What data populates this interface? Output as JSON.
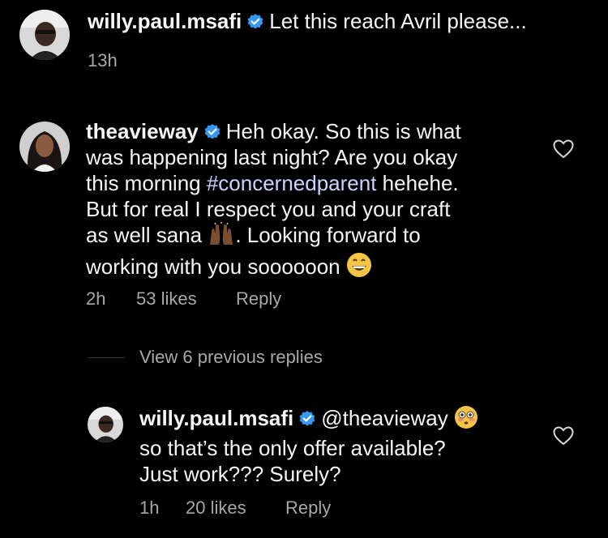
{
  "comment1": {
    "username": "willy.paul.msafi",
    "text": "Let this reach Avril please...",
    "time": "13h"
  },
  "comment2": {
    "username": "theavieway",
    "text_part1": "Heh okay. So this is what",
    "text_part2": "was happening last night? Are you okay",
    "text_part3_pre": "this morning ",
    "hashtag": "#concernedparent",
    "text_part3_post": " hehehe.",
    "text_part4": "But for real I respect you and your craft",
    "text_part5_pre": "as well sana ",
    "text_part5_post": ". Looking forward to",
    "text_part6": "working with you soooooon ",
    "time": "2h",
    "likes": "53 likes",
    "reply": "Reply"
  },
  "view_replies": "View 6 previous replies",
  "reply1": {
    "username": "willy.paul.msafi",
    "mention": "@theavieway",
    "text_line2": "so that’s the only offer available?",
    "text_line3": "Just work??? Surely?",
    "time": "1h",
    "likes": "20 likes",
    "reply": "Reply"
  },
  "colors": {
    "background": "#000000",
    "verified": "#3897f0",
    "meta": "#a8a8a8"
  },
  "icons": [
    "verified-badge-icon",
    "heart-icon",
    "raised-hands-emoji",
    "grinning-emoji",
    "flushed-emoji"
  ]
}
